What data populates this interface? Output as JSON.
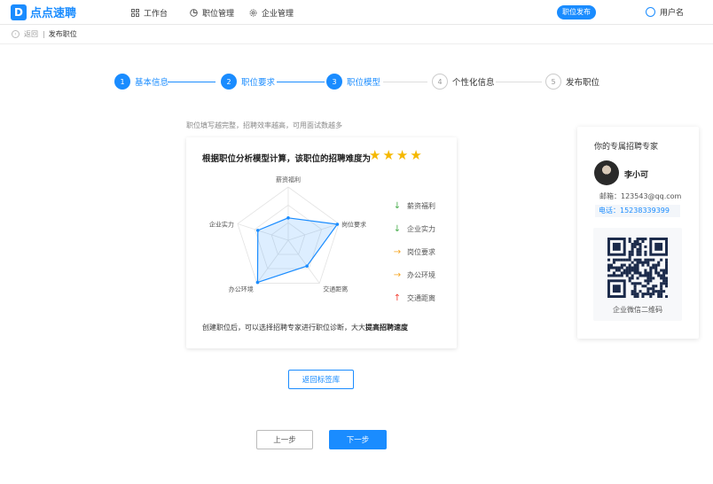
{
  "app": {
    "logo_glyph": "D",
    "logo_text": "点点速聘",
    "brand_color": "#1a8cff"
  },
  "nav": {
    "items": [
      {
        "label": "工作台",
        "icon": "grid-icon"
      },
      {
        "label": "职位管理",
        "icon": "pie-chart-icon"
      },
      {
        "label": "企业管理",
        "icon": "gear-icon"
      }
    ],
    "publish_label": "职位发布",
    "user_label": "用户名"
  },
  "breadcrumb": {
    "back_label": "返回",
    "separator": "|",
    "current": "发布职位"
  },
  "steps": [
    {
      "num": "1",
      "label": "基本信息",
      "state": "done"
    },
    {
      "num": "2",
      "label": "职位要求",
      "state": "done"
    },
    {
      "num": "3",
      "label": "职位模型",
      "state": "current"
    },
    {
      "num": "4",
      "label": "个性化信息",
      "state": "todo"
    },
    {
      "num": "5",
      "label": "发布职位",
      "state": "todo"
    }
  ],
  "hint": "职位填写越完整，招聘效率越高，可用面试数越多",
  "difficulty": {
    "title": "根据职位分析模型计算，该职位的招聘难度为",
    "stars": 4,
    "footer_prefix": "创建职位后，可以选择招聘专家进行职位诊断，大大",
    "footer_bold": "提高招聘速度"
  },
  "chart_data": {
    "type": "radar",
    "axes": [
      "薪资福利",
      "岗位要求",
      "交通距离",
      "办公环境",
      "企业实力"
    ],
    "values": [
      0.42,
      0.97,
      0.6,
      0.98,
      0.6
    ],
    "max": 1,
    "series_color": "#1a8cff"
  },
  "legend": [
    {
      "label": "薪资福利",
      "arrow": "↓",
      "color": "#4caf50"
    },
    {
      "label": "企业实力",
      "arrow": "↓",
      "color": "#4caf50"
    },
    {
      "label": "岗位要求",
      "arrow": "→",
      "color": "#f5a623"
    },
    {
      "label": "办公环境",
      "arrow": "→",
      "color": "#f5a623"
    },
    {
      "label": "交通距离",
      "arrow": "↑",
      "color": "#f44336"
    }
  ],
  "buttons": {
    "back_to_tags": "返回标签库",
    "prev": "上一步",
    "next": "下一步"
  },
  "expert": {
    "title": "你的专属招聘专家",
    "name": "李小可",
    "mail_label": "邮箱：",
    "mail": "123543@qq.com",
    "phone_label": "电话：",
    "phone": "15238339399",
    "qr_caption": "企业微信二维码"
  }
}
